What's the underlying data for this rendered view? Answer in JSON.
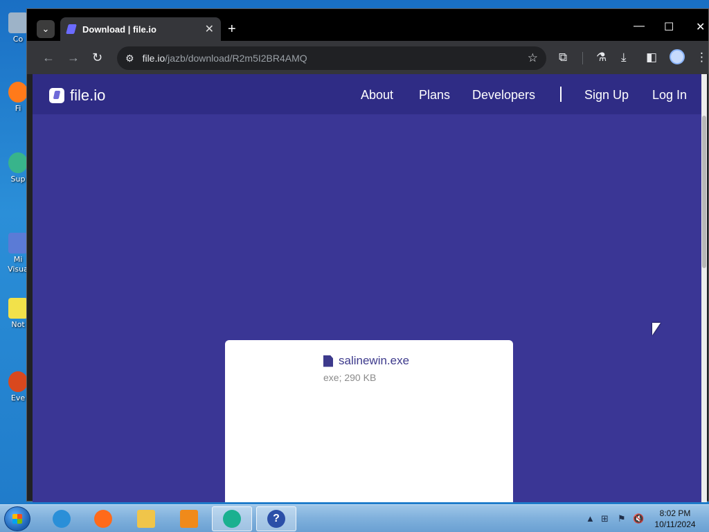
{
  "desktop": {
    "icons": [
      {
        "label": "Co",
        "color": "#9db3c8"
      },
      {
        "label": "Fi",
        "color": "#ff7a1a"
      },
      {
        "label": "Sup",
        "color": "#38b48b"
      },
      {
        "label": "Mi\nVisua",
        "color": "#5b7bd6"
      },
      {
        "label": "Not",
        "color": "#f2e14a"
      },
      {
        "label": "Eve",
        "color": "#d9481e"
      }
    ]
  },
  "browser": {
    "tab": {
      "title": "Download | file.io",
      "close_icon": "close-icon"
    },
    "new_tab_label": "+",
    "window_controls": {
      "minimize": "—",
      "maximize": "☐",
      "close": "✕"
    },
    "url_host": "file.io",
    "url_path": "/jazb/download/R2m5I2BR4AMQ"
  },
  "site": {
    "logo_text": "file.io",
    "nav": [
      "About",
      "Plans",
      "Developers",
      "Sign Up",
      "Log In"
    ]
  },
  "file": {
    "name": "salinewin.exe",
    "meta": "exe; 290 KB"
  },
  "taskbar": {
    "apps": [
      {
        "name": "internet-explorer",
        "color": "#2a8fd8"
      },
      {
        "name": "firefox",
        "color": "#ff6a1a"
      },
      {
        "name": "file-explorer",
        "color": "#f0c54a"
      },
      {
        "name": "media-player",
        "color": "#f08a1a"
      },
      {
        "name": "chrome-browser",
        "color": "#1ab08f"
      },
      {
        "name": "help",
        "color": "#2b4fa8"
      }
    ],
    "clock_time": "8:02 PM",
    "clock_date": "10/11/2024"
  }
}
